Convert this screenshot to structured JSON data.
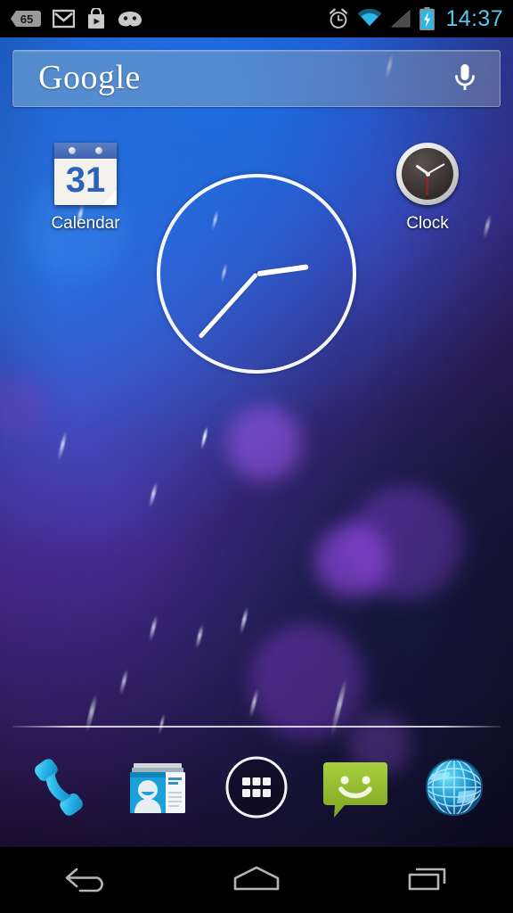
{
  "device": {
    "platform": "Android",
    "screen": "home-screen"
  },
  "status_bar": {
    "time": "14:37",
    "time_color": "#52c8f0",
    "left_icons": [
      {
        "name": "notification-count-badge",
        "label": "65"
      },
      {
        "name": "gmail-icon",
        "label": "M"
      },
      {
        "name": "play-store-icon",
        "label": "Play Store"
      },
      {
        "name": "android-jellybean-icon",
        "label": "Android"
      }
    ],
    "right_icons": [
      {
        "name": "alarm-icon",
        "label": "Alarm set"
      },
      {
        "name": "wifi-icon",
        "label": "Wi-Fi connected"
      },
      {
        "name": "cellular-signal-icon",
        "label": "No signal"
      },
      {
        "name": "battery-charging-icon",
        "label": "Charging"
      }
    ]
  },
  "search": {
    "logo_text": "Google",
    "placeholder": "Google",
    "mic_icon": "microphone-icon"
  },
  "shortcuts": [
    {
      "id": "calendar",
      "label": "Calendar",
      "icon": "calendar-icon",
      "day": "31"
    },
    {
      "id": "clock",
      "label": "Clock",
      "icon": "clock-icon"
    }
  ],
  "clock_widget": {
    "name": "analog-clock-widget",
    "time": "14:37",
    "hour_angle": 82,
    "minute_angle": 222,
    "color": "#ffffff"
  },
  "dock": {
    "items": [
      {
        "id": "phone",
        "label": "Phone",
        "icon": "phone-icon",
        "color": "#2ab4e8"
      },
      {
        "id": "people",
        "label": "People",
        "icon": "contacts-icon",
        "color": "#23a3dd"
      },
      {
        "id": "app-drawer",
        "label": "Apps",
        "icon": "app-drawer-icon",
        "color": "#ffffff"
      },
      {
        "id": "messaging",
        "label": "Messaging",
        "icon": "message-bubble-icon",
        "color": "#9cc котор"
      },
      {
        "id": "browser",
        "label": "Browser",
        "icon": "globe-icon",
        "color": "#2fb9e8"
      }
    ]
  },
  "nav_bar": {
    "buttons": [
      {
        "id": "back",
        "label": "Back",
        "icon": "back-arrow-icon"
      },
      {
        "id": "home",
        "label": "Home",
        "icon": "home-icon"
      },
      {
        "id": "recents",
        "label": "Recent apps",
        "icon": "recent-apps-icon"
      }
    ]
  }
}
